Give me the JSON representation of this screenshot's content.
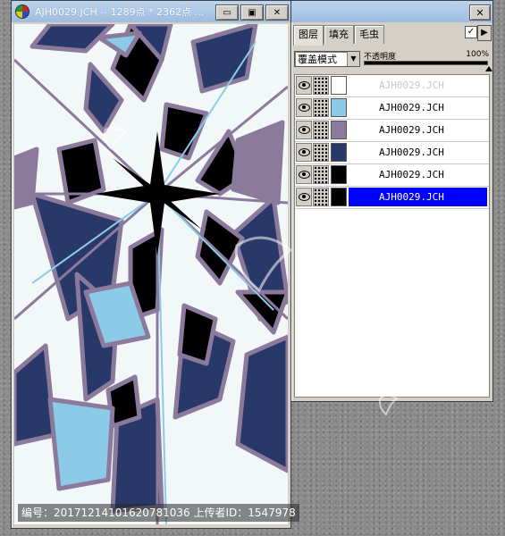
{
  "image_window": {
    "title": "AJH0029.JCH -- 1289点 * 2362点 ...",
    "buttons": {
      "minimize": "▭",
      "restore": "▣",
      "close": "✕"
    }
  },
  "layer_panel": {
    "tabs": [
      {
        "label": "图层",
        "active": true
      },
      {
        "label": "填充",
        "active": false
      },
      {
        "label": "毛虫",
        "active": false
      }
    ],
    "blend_mode": "覆盖模式",
    "opacity_label": "不透明度",
    "opacity_value": "100%",
    "opacity_fraction": 1.0,
    "check_mark": "✓",
    "menu_arrow": "▶",
    "close_button": "✕",
    "layers": [
      {
        "name": "AJH0029.JCH",
        "color": "#ffffff",
        "selected": false,
        "faded": true
      },
      {
        "name": "AJH0029.JCH",
        "color": "#8ccbe8",
        "selected": false,
        "faded": false
      },
      {
        "name": "AJH0029.JCH",
        "color": "#8c7a9c",
        "selected": false,
        "faded": false
      },
      {
        "name": "AJH0029.JCH",
        "color": "#283868",
        "selected": false,
        "faded": false
      },
      {
        "name": "AJH0029.JCH",
        "color": "#000000",
        "selected": false,
        "faded": false
      },
      {
        "name": "AJH0029.JCH",
        "color": "#000000",
        "selected": true,
        "faded": false
      }
    ]
  },
  "footer": {
    "caption": "编号：20171214101620781036 上传者ID：1547978"
  }
}
